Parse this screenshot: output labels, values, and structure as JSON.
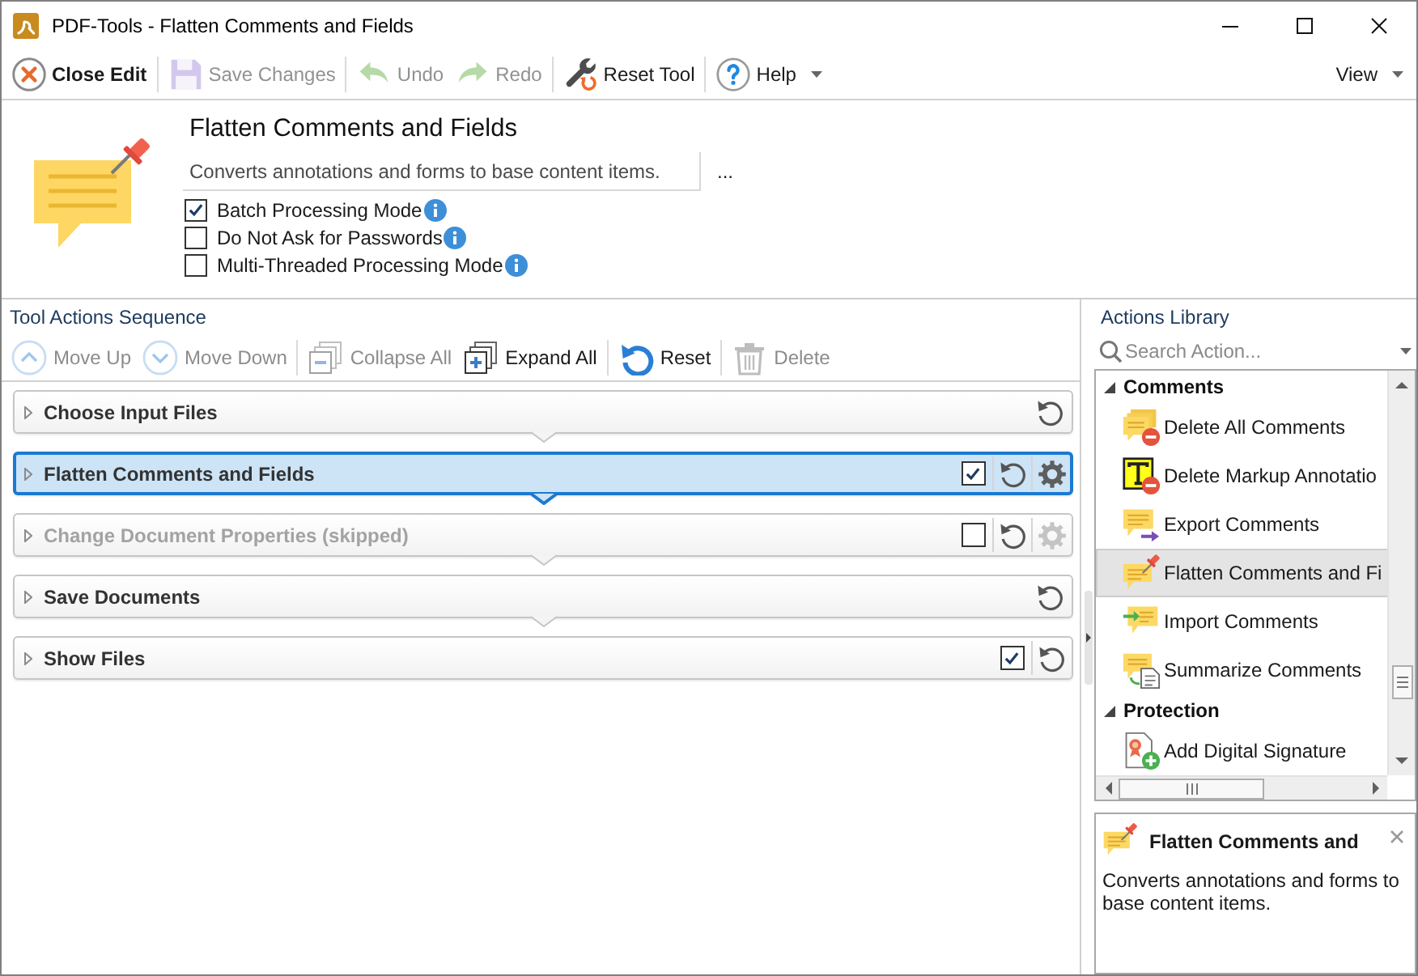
{
  "window": {
    "title": "PDF-Tools - Flatten Comments and Fields"
  },
  "toolbar": {
    "groups": [
      {
        "buttons": [
          {
            "label": "Close Edit",
            "kind": "close",
            "disabled": false,
            "dropdown": false
          }
        ]
      },
      {
        "buttons": [
          {
            "label": "Save Changes",
            "kind": "save",
            "disabled": true,
            "dropdown": false
          }
        ]
      },
      {
        "buttons": [
          {
            "label": "Undo",
            "kind": "undo",
            "disabled": true,
            "dropdown": false
          },
          {
            "label": "Redo",
            "kind": "redo",
            "disabled": true,
            "dropdown": false
          }
        ]
      },
      {
        "buttons": [
          {
            "label": "Reset Tool",
            "kind": "reset",
            "disabled": false,
            "dropdown": false
          }
        ]
      },
      {
        "buttons": [
          {
            "label": "Help",
            "kind": "help",
            "disabled": false,
            "dropdown": true
          }
        ]
      }
    ],
    "view_menu": {
      "label": "View"
    }
  },
  "tool": {
    "title": "Flatten Comments and Fields",
    "description": "Converts annotations and forms to base content items.",
    "more_button": "...",
    "options": [
      {
        "label": "Batch Processing Mode",
        "checked": true
      },
      {
        "label": "Do Not Ask for Passwords",
        "checked": false
      },
      {
        "label": "Multi-Threaded Processing Mode",
        "checked": false
      }
    ]
  },
  "sequence": {
    "title": "Tool Actions Sequence",
    "toolbar": {
      "groups": [
        {
          "buttons": [
            {
              "label": "Move Up",
              "kind": "move_up",
              "disabled": true
            },
            {
              "label": "Move Down",
              "kind": "move_down",
              "disabled": true
            }
          ]
        },
        {
          "buttons": [
            {
              "label": "Collapse All",
              "kind": "collapse_all",
              "disabled": true
            },
            {
              "label": "Expand All",
              "kind": "expand_all",
              "disabled": false
            }
          ]
        },
        {
          "buttons": [
            {
              "label": "Reset",
              "kind": "reset",
              "disabled": false
            }
          ]
        },
        {
          "buttons": [
            {
              "label": "Delete",
              "kind": "delete",
              "disabled": true
            }
          ]
        }
      ]
    },
    "actions": [
      {
        "label": "Choose Input Files",
        "selected": false,
        "expanded": false,
        "skipped": false
      },
      {
        "label": "Flatten Comments and Fields",
        "selected": true,
        "expanded": false,
        "skipped": false,
        "toggle": {
          "checked": true
        },
        "settings": {
          "disabled": false
        }
      },
      {
        "label": "Change Document Properties (skipped)",
        "selected": false,
        "expanded": false,
        "skipped": true,
        "toggle": {
          "checked": false
        },
        "settings": {
          "disabled": true
        }
      },
      {
        "label": "Save Documents",
        "selected": false,
        "expanded": false,
        "skipped": false
      },
      {
        "label": "Show Files",
        "selected": false,
        "expanded": false,
        "skipped": false,
        "toggle": {
          "checked": true
        }
      }
    ]
  },
  "library": {
    "title": "Actions Library",
    "search": {
      "placeholder": "Search Action..."
    },
    "categories": [
      {
        "label": "Comments",
        "expanded": true,
        "children": [
          {
            "label": "Delete All Comments",
            "kind": "delete_all",
            "selected": false
          },
          {
            "label": "Delete Markup Annotatio",
            "kind": "delete_markup",
            "selected": false
          },
          {
            "label": "Export Comments",
            "kind": "export",
            "selected": false
          },
          {
            "label": "Flatten Comments and Fi",
            "kind": "flatten",
            "selected": true
          },
          {
            "label": "Import Comments",
            "kind": "import",
            "selected": false
          },
          {
            "label": "Summarize Comments",
            "kind": "summarize",
            "selected": false
          }
        ]
      },
      {
        "label": "Protection",
        "expanded": true,
        "children": [
          {
            "label": "Add Digital Signature",
            "kind": "signature",
            "selected": false
          }
        ]
      }
    ]
  },
  "info_panel": {
    "title": "Flatten Comments and",
    "description": "Converts annotations and forms to base content items."
  }
}
